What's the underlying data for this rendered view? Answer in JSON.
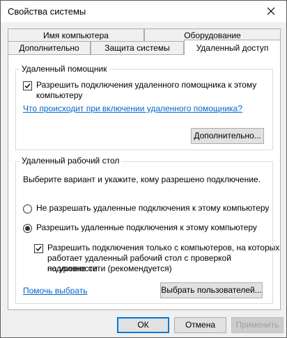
{
  "window": {
    "title": "Свойства системы"
  },
  "tabs": {
    "row1": [
      "Имя компьютера",
      "Оборудование"
    ],
    "row2": [
      "Дополнительно",
      "Защита системы",
      "Удаленный доступ"
    ],
    "active": "Удаленный доступ"
  },
  "remote_assistance": {
    "caption": "Удаленный помощник",
    "allow_checkbox_label_line1": "Разрешить подключения удаленного помощника к этому",
    "allow_checkbox_label_line2": "компьютеру",
    "allow_checked": true,
    "help_link": "Что происходит при включении удаленного помощника?",
    "advanced_button": "Дополнительно..."
  },
  "remote_desktop": {
    "caption": "Удаленный рабочий стол",
    "instruction": "Выберите вариант и укажите, кому разрешено подключение.",
    "option_deny": "Не разрешать удаленные подключения к этому компьютеру",
    "option_allow": "Разрешить удаленные подключения к этому компьютеру",
    "selected_option": "allow",
    "nla_label_line1": "Разрешить подключения только с компьютеров, на которых",
    "nla_label_line2": "работает удаленный рабочий стол с проверкой подлинности",
    "nla_label_line3": "на уровне сети (рекомендуется)",
    "nla_checked": true,
    "help_choose_link": "Помочь выбрать",
    "select_users_button": "Выбрать пользователей..."
  },
  "footer": {
    "ok": "ОК",
    "cancel": "Отмена",
    "apply": "Применить"
  }
}
